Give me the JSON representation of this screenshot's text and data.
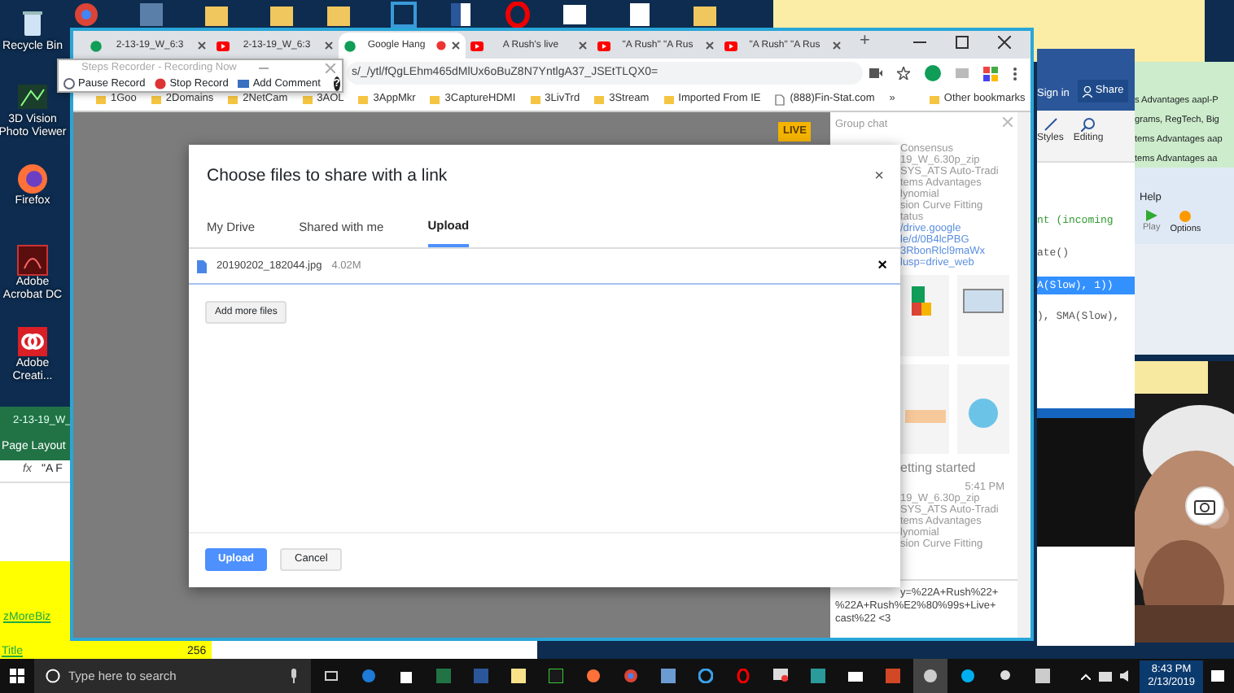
{
  "desktop_icons": [
    {
      "label": "Recycle Bin",
      "kind": "bin"
    },
    {
      "label": "3D Vision Photo Viewer",
      "kind": "viewer"
    },
    {
      "label": "Firefox",
      "kind": "firefox"
    },
    {
      "label": "Adobe Acrobat DC",
      "kind": "acrobat"
    },
    {
      "label": "Adobe Creati...",
      "kind": "creative"
    }
  ],
  "excel": {
    "title": "2-13-19_W_",
    "ribbon_tab": "Page Layout",
    "fx": "fx",
    "formula": "\"A F",
    "link_cell": "zMoreBiz",
    "title_cell": "Title",
    "number_cell": "256"
  },
  "chrome": {
    "tabs": [
      {
        "label": "2-13-19_W_6:3",
        "kind": "hangouts",
        "selected": false,
        "recording": false
      },
      {
        "label": "2-13-19_W_6:3",
        "kind": "youtube",
        "selected": false,
        "recording": false
      },
      {
        "label": "Google Hang",
        "kind": "hangouts",
        "selected": true,
        "recording": true
      },
      {
        "label": "A Rush's live",
        "kind": "youtube",
        "selected": false,
        "recording": false
      },
      {
        "label": "\"A Rush\" \"A Rus",
        "kind": "youtube",
        "selected": false,
        "recording": false
      },
      {
        "label": "\"A Rush\" \"A Rus",
        "kind": "youtube",
        "selected": false,
        "recording": false
      }
    ],
    "new_tab": "+",
    "address": "s/_/ytl/fQgLEhm465dMlUx6oBuZ8N7YntlgA37_JSEtTLQX0=",
    "bookmarks": [
      {
        "label": "1Goo",
        "kind": "folder"
      },
      {
        "label": "2Domains",
        "kind": "folder"
      },
      {
        "label": "2NetCam",
        "kind": "folder"
      },
      {
        "label": "3AOL",
        "kind": "folder"
      },
      {
        "label": "3AppMkr",
        "kind": "folder"
      },
      {
        "label": "3CaptureHDMI",
        "kind": "folder"
      },
      {
        "label": "3LivTrd",
        "kind": "folder"
      },
      {
        "label": "3Stream",
        "kind": "folder"
      },
      {
        "label": "Imported From IE",
        "kind": "folder"
      },
      {
        "label": "(888)Fin-Stat.com",
        "kind": "page"
      }
    ],
    "bookmarks_more": "»",
    "other_bookmarks": "Other bookmarks",
    "live_badge": "LIVE",
    "group_chat": {
      "title": "Group chat",
      "lines": [
        {
          "text": "Consensus",
          "kind": "text"
        },
        {
          "text": "19_W_6.30p_zip",
          "kind": "text"
        },
        {
          "text": "SYS_ATS Auto-Tradi",
          "kind": "text"
        },
        {
          "text": "tems Advantages",
          "kind": "text"
        },
        {
          "text": "lynomial",
          "kind": "text"
        },
        {
          "text": "sion Curve Fitting",
          "kind": "text"
        },
        {
          "text": "tatus",
          "kind": "text"
        },
        {
          "text": "/drive.google",
          "kind": "link"
        },
        {
          "text": "le/d/0B4lcPBG",
          "kind": "link"
        },
        {
          "text": "3RbonRlcl9maWx",
          "kind": "link"
        },
        {
          "text": "lusp=drive_web",
          "kind": "link"
        }
      ],
      "heading": "etting started",
      "time": "5:41 PM",
      "lines_2": [
        {
          "text": "19_W_6.30p_zip",
          "kind": "text"
        },
        {
          "text": "SYS_ATS Auto-Tradi",
          "kind": "text"
        },
        {
          "text": "tems Advantages",
          "kind": "text"
        },
        {
          "text": "lynomial",
          "kind": "text"
        },
        {
          "text": "sion Curve Fitting",
          "kind": "text"
        }
      ],
      "message": "y=%22A+Rush%22+ %22A+Rush%E2%80%99s+Live+ cast%22 <3"
    },
    "dialog": {
      "title": "Choose files to share with a link",
      "close": "×",
      "tabs": [
        {
          "label": "My Drive",
          "selected": false
        },
        {
          "label": "Shared with me",
          "selected": false
        },
        {
          "label": "Upload",
          "selected": true
        }
      ],
      "file": {
        "name": "20190202_182044.jpg",
        "size": "4.02M",
        "remove": "×"
      },
      "add_more": "Add more files",
      "upload": "Upload",
      "cancel": "Cancel"
    }
  },
  "steps_recorder": {
    "title": "Steps Recorder - Recording Now",
    "buttons": [
      {
        "label": "Pause Record",
        "kind": "pause"
      },
      {
        "label": "Stop Record",
        "kind": "stop"
      },
      {
        "label": "Add Comment",
        "kind": "comment"
      }
    ],
    "help": "?"
  },
  "word": {
    "sign_in": "Sign in",
    "share": "Share",
    "styles": "Styles",
    "editing": "Editing",
    "code_lines": [
      {
        "text": "nt (incoming",
        "selected": false
      },
      {
        "text": "ate()",
        "selected": false
      },
      {
        "text": "A(Slow), 1))",
        "selected": true
      },
      {
        "text": "), SMA(Slow),",
        "selected": false
      }
    ]
  },
  "notes": [
    "s Advantages aapl-P",
    "grams, RegTech, Big",
    "tems Advantages aap",
    "tems Advantages aa"
  ],
  "player": {
    "menu": "Help",
    "play": "Play",
    "options": "Options"
  },
  "taskbar": {
    "search_placeholder": "Type here to search",
    "time": "8:43 PM",
    "date": "2/13/2019"
  }
}
